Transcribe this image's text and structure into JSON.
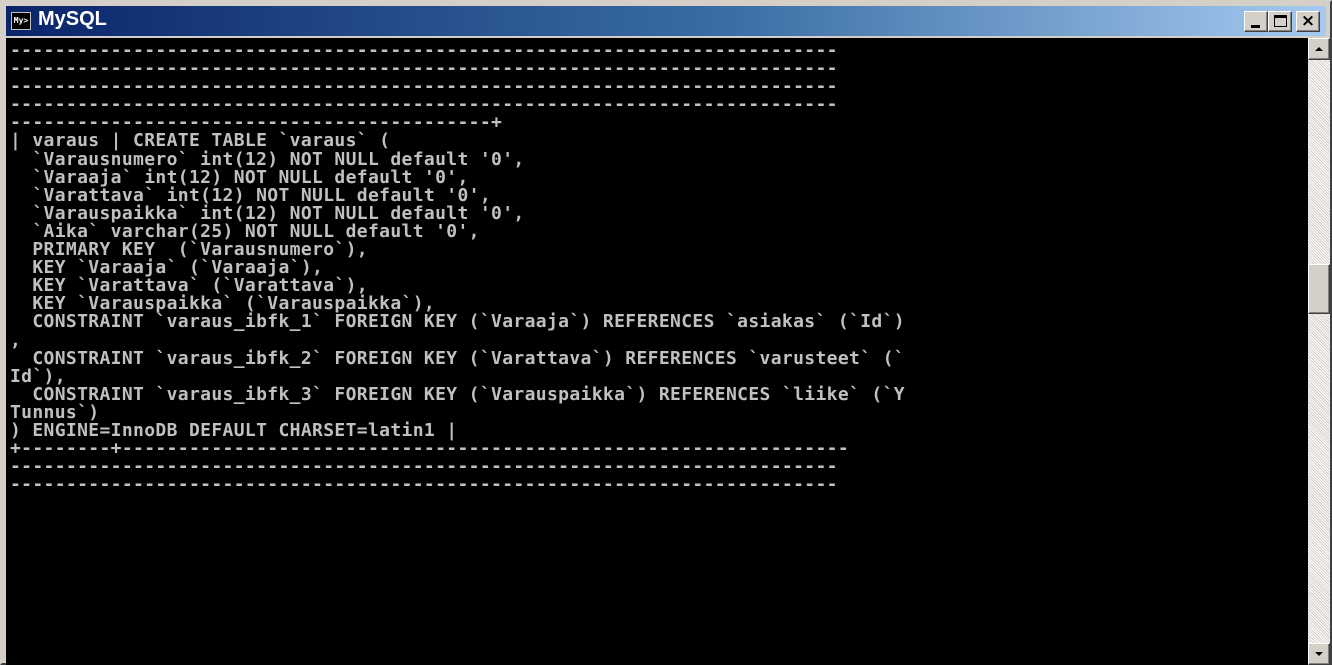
{
  "window": {
    "title": "MySQL",
    "icon_label": "MySQL",
    "icon": "mysql-console-icon",
    "controls": {
      "minimize_icon": "minimize-icon",
      "maximize_icon": "maximize-icon",
      "close_icon": "close-icon",
      "close_glyph": "×"
    }
  },
  "console": {
    "text": "--------------------------------------------------------------------------\n--------------------------------------------------------------------------\n--------------------------------------------------------------------------\n--------------------------------------------------------------------------\n-------------------------------------------+\n| varaus | CREATE TABLE `varaus` (\n  `Varausnumero` int(12) NOT NULL default '0',\n  `Varaaja` int(12) NOT NULL default '0',\n  `Varattava` int(12) NOT NULL default '0',\n  `Varauspaikka` int(12) NOT NULL default '0',\n  `Aika` varchar(25) NOT NULL default '0',\n  PRIMARY KEY  (`Varausnumero`),\n  KEY `Varaaja` (`Varaaja`),\n  KEY `Varattava` (`Varattava`),\n  KEY `Varauspaikka` (`Varauspaikka`),\n  CONSTRAINT `varaus_ibfk_1` FOREIGN KEY (`Varaaja`) REFERENCES `asiakas` (`Id`)\n,\n  CONSTRAINT `varaus_ibfk_2` FOREIGN KEY (`Varattava`) REFERENCES `varusteet` (`\nId`),\n  CONSTRAINT `varaus_ibfk_3` FOREIGN KEY (`Varauspaikka`) REFERENCES `liike` (`Y\nTunnus`)\n) ENGINE=InnoDB DEFAULT CHARSET=latin1 |\n+--------+-----------------------------------------------------------------\n--------------------------------------------------------------------------\n--------------------------------------------------------------------------"
  },
  "scrollbar": {
    "up_icon": "scroll-up-arrow-icon",
    "down_icon": "scroll-down-arrow-icon",
    "position": 0.4
  },
  "colors": {
    "titlebar_start": "#0a246a",
    "titlebar_end": "#a6caf0",
    "console_bg": "#000000",
    "console_fg": "#c0c0c0"
  }
}
